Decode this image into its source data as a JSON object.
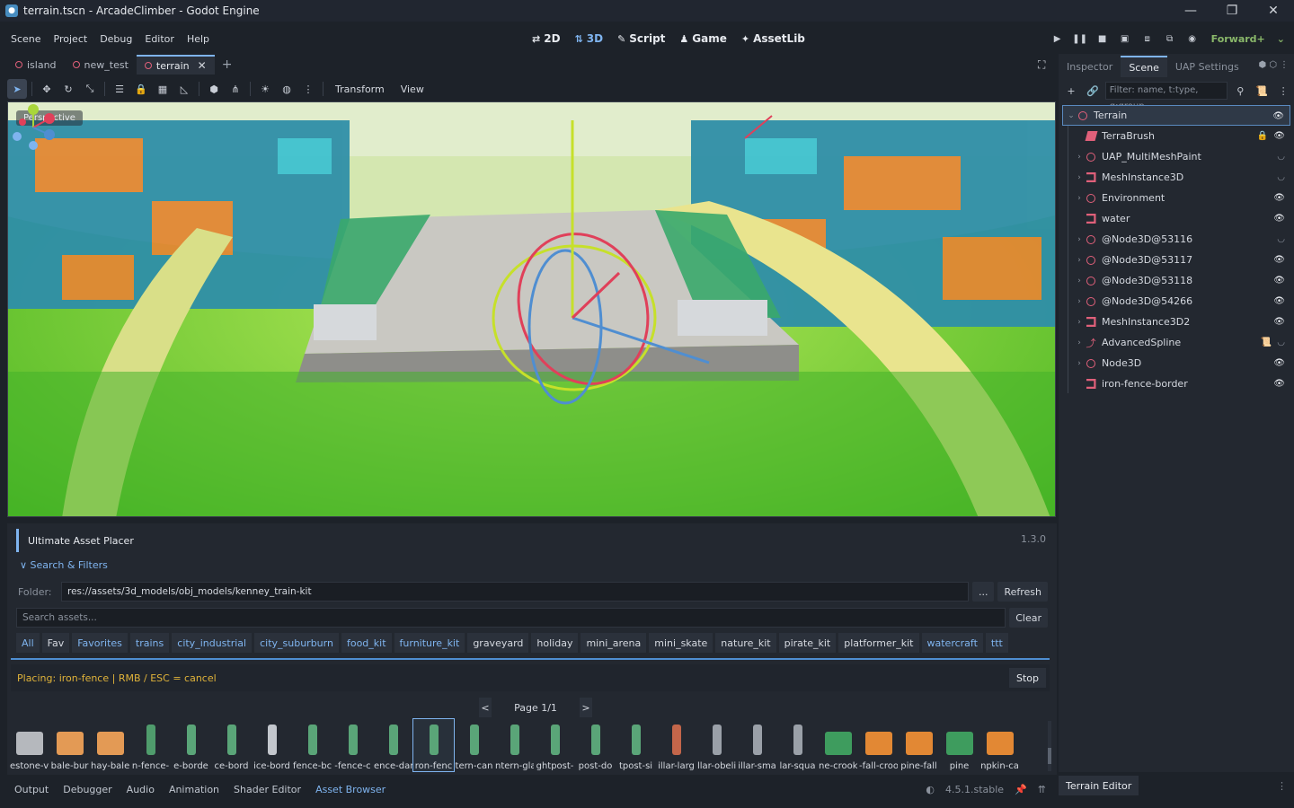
{
  "window": {
    "title": "terrain.tscn - ArcadeClimber - Godot Engine",
    "controls": [
      "—",
      "❐",
      "✕"
    ]
  },
  "menu": {
    "items": [
      "Scene",
      "Project",
      "Debug",
      "Editor",
      "Help"
    ]
  },
  "workspaces": [
    {
      "icon": "⇄",
      "label": "2D"
    },
    {
      "icon": "⇅",
      "label": "3D"
    },
    {
      "icon": "✎",
      "label": "Script"
    },
    {
      "icon": "♟",
      "label": "Game"
    },
    {
      "icon": "✦",
      "label": "AssetLib"
    }
  ],
  "renderer": "Forward+",
  "scene_tabs": [
    {
      "label": "island"
    },
    {
      "label": "new_test"
    },
    {
      "label": "terrain"
    }
  ],
  "viewport_toolbar": {
    "transform_label": "Transform",
    "view_label": "View"
  },
  "viewport": {
    "perspective_label": "Perspective"
  },
  "asset_placer": {
    "title": "Ultimate Asset Placer",
    "version": "1.3.0",
    "search_filters_label": "∨ Search & Filters",
    "folder_label": "Folder:",
    "folder_value": "res://assets/3d_models/obj_models/kenney_train-kit",
    "browse_label": "...",
    "refresh_label": "Refresh",
    "search_placeholder": "Search assets...",
    "clear_label": "Clear",
    "categories": [
      "All",
      "Fav",
      "Favorites",
      "trains",
      "city_industrial",
      "city_suburburn",
      "food_kit",
      "furniture_kit",
      "graveyard",
      "holiday",
      "mini_arena",
      "mini_skate",
      "nature_kit",
      "pirate_kit",
      "platformer_kit",
      "watercraft",
      "ttt"
    ],
    "placing_text": "Placing: iron-fence   |   RMB / ESC = cancel",
    "stop_label": "Stop",
    "page_label": "Page 1/1",
    "prev_label": "<",
    "next_label": ">",
    "assets": [
      "estone-v",
      "bale-bur",
      "hay-bale",
      "n-fence-",
      "e-borde",
      "ce-bord",
      "ice-bord",
      "fence-bc",
      "-fence-c",
      "ence-dar",
      "ron-fenc",
      "tern-can",
      "ntern-gla",
      "ghtpost-",
      "post-do",
      "tpost-si",
      "illar-larg",
      "llar-obeli",
      "illar-sma",
      "lar-squa",
      "ne-crook",
      "-fall-croo",
      "pine-fall",
      "pine",
      "npkin-ca"
    ]
  },
  "bottom_tabs": [
    "Output",
    "Debugger",
    "Audio",
    "Animation",
    "Shader Editor",
    "Asset Browser"
  ],
  "engine_version": "4.5.1.stable",
  "right_dock": {
    "tabs": [
      "Inspector",
      "Scene",
      "UAP Settings"
    ],
    "filter_placeholder": "Filter: name, t:type, g:group",
    "tree": [
      {
        "label": "Terrain",
        "icon": "circle",
        "expander": "⌄",
        "eye": "👁",
        "root": true
      },
      {
        "label": "TerraBrush",
        "icon": "brush",
        "expander": "",
        "eye": "👁",
        "lock": "🔒"
      },
      {
        "label": "UAP_MultiMeshPaint",
        "icon": "circle",
        "expander": "›",
        "eye": "◡",
        "eye_closed": true
      },
      {
        "label": "MeshInstance3D",
        "icon": "mesh",
        "expander": "›",
        "eye": "◡",
        "eye_closed": true
      },
      {
        "label": "Environment",
        "icon": "circle",
        "expander": "›",
        "eye": "👁"
      },
      {
        "label": "water",
        "icon": "mesh",
        "expander": "",
        "eye": "👁"
      },
      {
        "label": "@Node3D@53116",
        "icon": "circle",
        "expander": "›",
        "eye": "◡",
        "eye_closed": true
      },
      {
        "label": "@Node3D@53117",
        "icon": "circle",
        "expander": "›",
        "eye": "👁"
      },
      {
        "label": "@Node3D@53118",
        "icon": "circle",
        "expander": "›",
        "eye": "👁"
      },
      {
        "label": "@Node3D@54266",
        "icon": "circle",
        "expander": "›",
        "eye": "👁"
      },
      {
        "label": "MeshInstance3D2",
        "icon": "mesh",
        "expander": "›",
        "eye": "👁"
      },
      {
        "label": "AdvancedSpline",
        "icon": "spline",
        "expander": "›",
        "eye": "◡",
        "eye_closed": true,
        "script": "📜"
      },
      {
        "label": "Node3D",
        "icon": "circle",
        "expander": "›",
        "eye": "👁"
      },
      {
        "label": "iron-fence-border",
        "icon": "mesh",
        "expander": "",
        "eye": "👁"
      }
    ]
  },
  "terrain_editor_tab": "Terrain Editor"
}
